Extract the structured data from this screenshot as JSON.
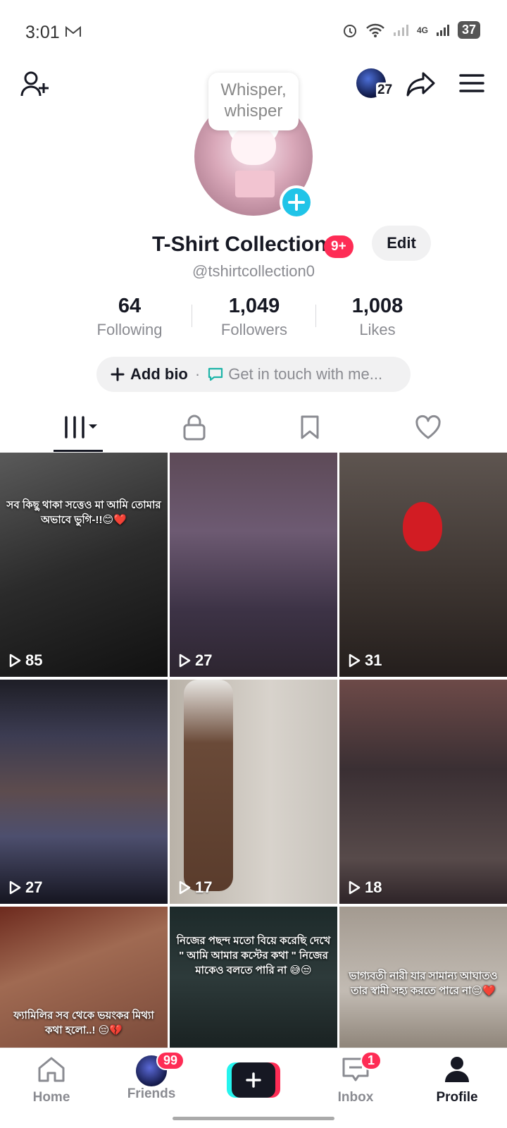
{
  "status": {
    "time": "3:01",
    "network": "4G",
    "battery": "37"
  },
  "header": {
    "friend_count": "27"
  },
  "profile": {
    "whisper": "Whisper, whisper",
    "name": "T-Shirt Collection",
    "name_badge": "9+",
    "edit_label": "Edit",
    "handle": "@tshirtcollection0"
  },
  "stats": [
    {
      "value": "64",
      "label": "Following"
    },
    {
      "value": "1,049",
      "label": "Followers"
    },
    {
      "value": "1,008",
      "label": "Likes"
    }
  ],
  "bio": {
    "add_label": "Add bio",
    "contact_label": "Get in touch with me..."
  },
  "videos": [
    {
      "plays": "85",
      "caption": "সব কিছু থাকা সত্তেও মা আমি তোমার অভাবে ভুগি-!!😊❤️"
    },
    {
      "plays": "27",
      "caption": ""
    },
    {
      "plays": "31",
      "caption": ""
    },
    {
      "plays": "27",
      "caption": ""
    },
    {
      "plays": "17",
      "caption": ""
    },
    {
      "plays": "18",
      "caption": ""
    },
    {
      "plays": "",
      "caption": "ফ্যামিলির সব থেকে ভয়ংকর মিথ্যা কথা হলো..! 😔💔"
    },
    {
      "plays": "",
      "caption": "নিজের পছন্দ মতো বিয়ে করেছি দেখে \" আমি আমার কস্টের কথা \" নিজের মাকেও বলতে পারি না 😅😒"
    },
    {
      "plays": "",
      "caption": "ভাগ্যবতী নারী যার সামান্য আঘাতও তার স্বামী সহ্য করতে পারে না😔❤️"
    }
  ],
  "nav": {
    "home": "Home",
    "friends": "Friends",
    "friends_badge": "99",
    "inbox": "Inbox",
    "inbox_badge": "1",
    "profile": "Profile"
  },
  "colors": {
    "accent": "#fe2c55",
    "cyan": "#25f4ee",
    "plus": "#20c4e8"
  }
}
